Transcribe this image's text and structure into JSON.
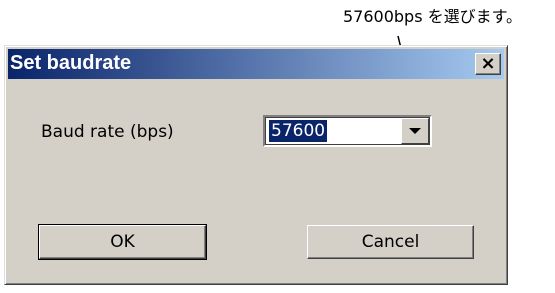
{
  "annotation": {
    "text": "57600bps を選びます。"
  },
  "dialog": {
    "title": "Set baudrate",
    "close_label": "×",
    "baud_label": "Baud rate (bps)",
    "baud_value": "57600",
    "ok_label": "OK",
    "cancel_label": "Cancel"
  },
  "colors": {
    "title_gradient_start": "#0a246a",
    "title_gradient_end": "#a6caf0",
    "dialog_face": "#d4d0c8",
    "selection": "#0a246a"
  },
  "icons": {
    "close": "close-icon",
    "dropdown": "chevron-down-icon"
  }
}
